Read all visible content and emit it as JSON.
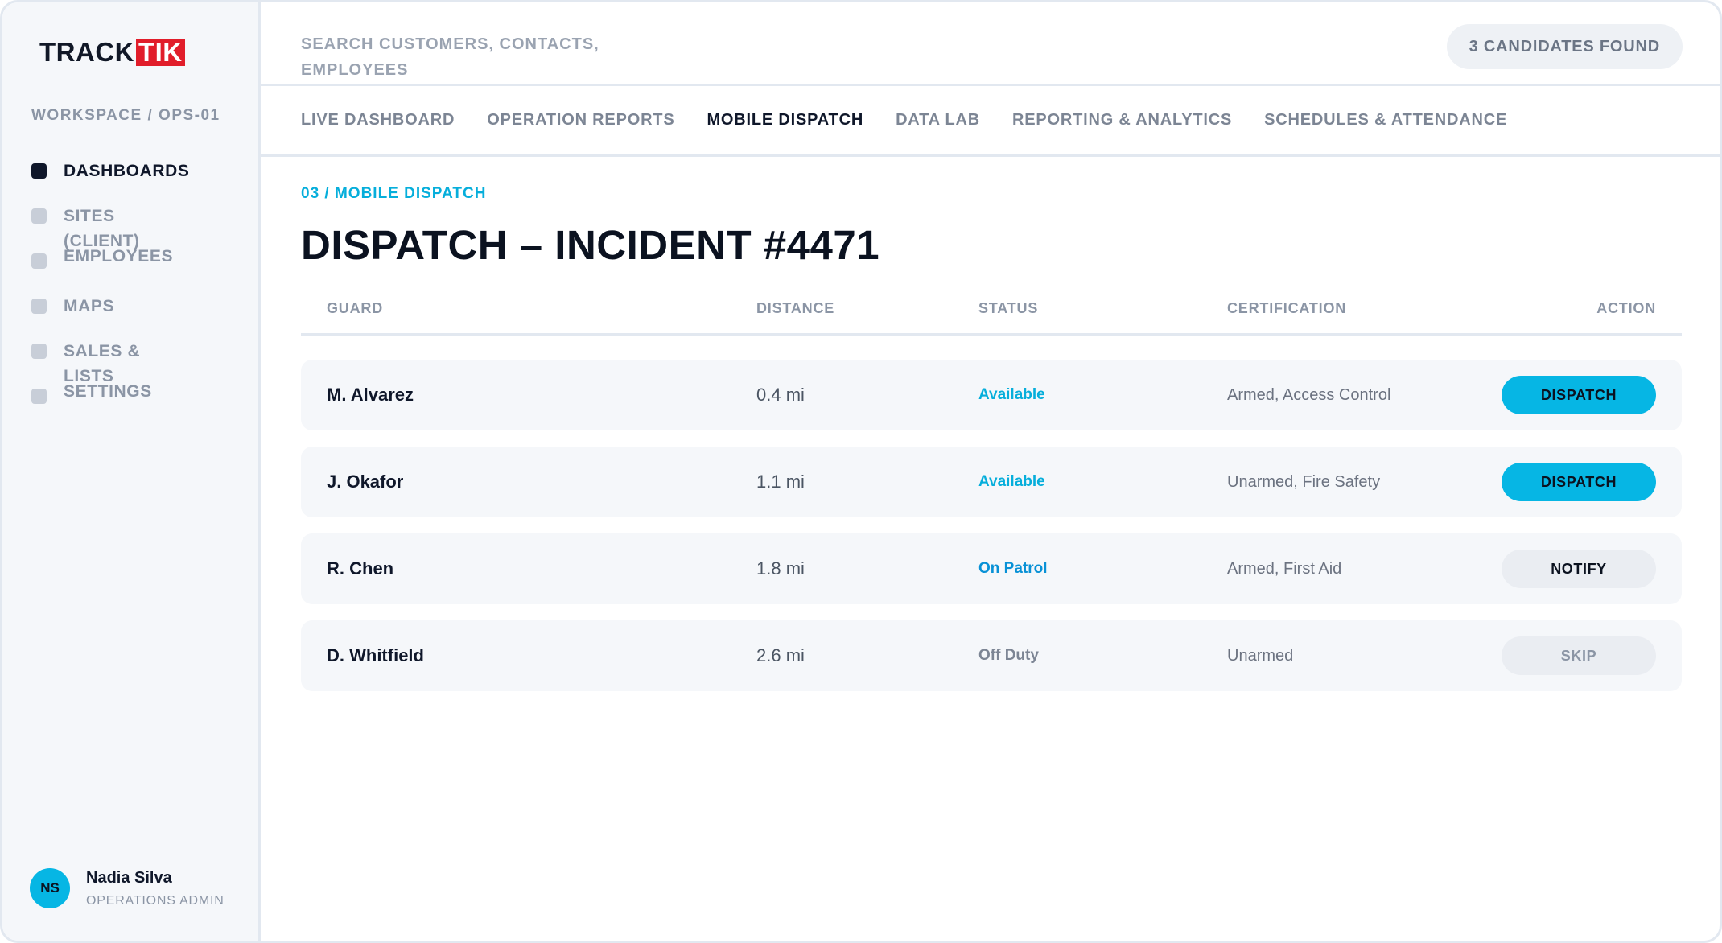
{
  "brand": {
    "word1": "TRACK",
    "word2": "TIK"
  },
  "sidebar": {
    "workspace": "WORKSPACE / OPS-01",
    "items": [
      {
        "label": "DASHBOARDS",
        "active": true
      },
      {
        "label": "SITES (CLIENT)",
        "active": false
      },
      {
        "label": "EMPLOYEES",
        "active": false
      },
      {
        "label": "MAPS",
        "active": false
      },
      {
        "label": "SALES & LISTS",
        "active": false
      },
      {
        "label": "SETTINGS",
        "active": false
      }
    ],
    "user": {
      "initials": "NS",
      "name": "Nadia Silva",
      "role": "OPERATIONS ADMIN"
    }
  },
  "header": {
    "search_placeholder": "SEARCH CUSTOMERS, CONTACTS, EMPLOYEES",
    "candidates_badge": "3 CANDIDATES FOUND"
  },
  "tabs": [
    {
      "label": "LIVE DASHBOARD",
      "active": false
    },
    {
      "label": "OPERATION REPORTS",
      "active": false
    },
    {
      "label": "MOBILE DISPATCH",
      "active": true
    },
    {
      "label": "DATA LAB",
      "active": false
    },
    {
      "label": "REPORTING & ANALYTICS",
      "active": false
    },
    {
      "label": "SCHEDULES & ATTENDANCE",
      "active": false
    }
  ],
  "main": {
    "breadcrumb": "03 / MOBILE DISPATCH",
    "title": "DISPATCH – INCIDENT #4471",
    "columns": {
      "guard": "GUARD",
      "distance": "DISTANCE",
      "status": "STATUS",
      "certification": "CERTIFICATION",
      "action": "ACTION"
    },
    "rows": [
      {
        "guard": "M. Alvarez",
        "distance": "0.4 mi",
        "status": "Available",
        "certification": "Armed, Access Control",
        "action": "DISPATCH"
      },
      {
        "guard": "J. Okafor",
        "distance": "1.1 mi",
        "status": "Available",
        "certification": "Unarmed, Fire Safety",
        "action": "DISPATCH"
      },
      {
        "guard": "R. Chen",
        "distance": "1.8 mi",
        "status": "On Patrol",
        "certification": "Armed, First Aid",
        "action": "NOTIFY"
      },
      {
        "guard": "D. Whitfield",
        "distance": "2.6 mi",
        "status": "Off Duty",
        "certification": "Unarmed",
        "action": "SKIP"
      }
    ]
  },
  "colors": {
    "accent": "#06b6e4",
    "brand_red": "#e11d2a",
    "text_dark": "#0f172a",
    "muted": "#8b95a5"
  }
}
